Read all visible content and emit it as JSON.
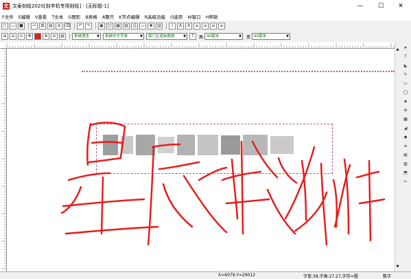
{
  "window": {
    "title": "文泰刻绘2020[刻字机专用刻绘] - [无标题-1]",
    "minimize": "—",
    "maximize": "☐",
    "close": "✕"
  },
  "menu": {
    "items": [
      "F文件",
      "E编辑",
      "V查看",
      "T文本",
      "G图形",
      "B表格",
      "A整齐",
      "K节点编辑",
      "R高级功能",
      "O选项",
      "W窗口",
      "H帮助"
    ]
  },
  "toolbar2": {
    "language": "系统语言",
    "chinese_font": "系统中文字体",
    "english_font": "南门正道标题体",
    "height_label": "高",
    "height_value": "40毫米",
    "width_label": "宽",
    "width_value": "40毫米"
  },
  "status": {
    "coords": "X=6079,Y=29012",
    "font_info": "字宽:38,字高:27.27,字符=圆",
    "mode": "数字"
  },
  "colors": {
    "scribble": "#e81c1c",
    "frame": "#b0568a"
  }
}
